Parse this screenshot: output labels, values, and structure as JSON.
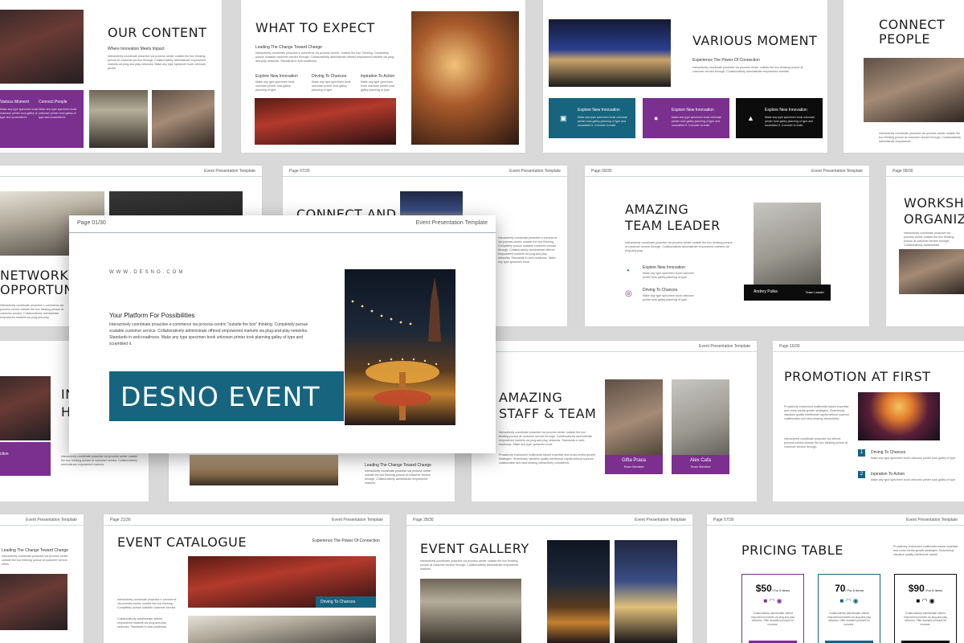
{
  "colors": {
    "purple": "#7b2f8f",
    "teal": "#17647f",
    "black": "#0c0c0c",
    "background": "#d9d9d9"
  },
  "slides": {
    "our_content": {
      "title": "OUR CONTENT",
      "subtitle": "Where Innovation Meets Impact",
      "body": "Interactively coordinate proactive via process center outside the box thinking pursue at customer service through. Collaboratively administrate empowered markets via plug-and-play networks. Make any type specimen book unknown printer.",
      "box1_title": "Various Moment",
      "box1_body": "Make any type specimen book unknown printer took galley of type and scrambled it.",
      "box2_title": "Connect People",
      "box2_body": "Make any type specimen book unknown printer took galley of type and scrambled it."
    },
    "what_to_expect": {
      "title": "WHAT TO EXPECT",
      "subtitle": "Leading The Change Toward Change",
      "body": "Interactively coordinate proactive e-commerce via process-centric \"outside the box\" thinking. Completely pursue scalable customer service through. Collaboratively administrate offered empowered markets via plug-and-play networks. Standards in web-readiness.",
      "cols": [
        {
          "title": "Explore New Innovation",
          "body": "Make any type specimen book unknown printer took galley planning of type."
        },
        {
          "title": "Driving To Chances",
          "body": "Make any type specimen book unknown printer took galley planning of type."
        },
        {
          "title": "Inpiration To Action",
          "body": "Make any type specimen book unknown printer took galley planning of type."
        }
      ]
    },
    "various_moment": {
      "title": "VARIOUS MOMENT",
      "subtitle": "Experience The Power Of Connection",
      "body": "Interactively coordinate proactive via process center outside the box thinking pursue at customer service through. Collaboratively administrate empowered markets.",
      "boxes": [
        {
          "title": "Explore New Innovation",
          "body": "Make any type specimen book unknown printer took galley planning of type and scrambled it. Consider to build.",
          "icon": "camera-icon"
        },
        {
          "title": "Explore New Innovation",
          "body": "Make any type specimen book unknown printer took galley planning of type and scrambled it. Consider to build.",
          "icon": "users-icon"
        },
        {
          "title": "Explore New Innovation",
          "body": "Make any type specimen book unknown printer took galley planning of type and scrambled it. Consider to build.",
          "icon": "image-icon"
        }
      ]
    },
    "connect_people": {
      "title": "CONNECT PEOPLE",
      "body": "Interactively coordinate proactive via process center outside the box thinking pursue at customer service through. Collaboratively administrate empowered."
    },
    "networking": {
      "title": "NETWORKING OPPORTUNI",
      "body": "Interactively coordinate proactive e-commerce via process-centric outside the box thinking pursue at customer service. Collaboratively administrate empowered markets via plug-and-play."
    },
    "connect_and": {
      "page": "Page 07/30",
      "template": "Event Presentation Template",
      "title": "CONNECT AND",
      "body": "Interactively coordinate proactive e-commerce via process-centric outside the box thinking. Completely pursue scalable customer service through. Collaboratively administrate offered empowered markets via plug-and-play networks. Standards in web-readiness. Make any type specimen book."
    },
    "team_leader": {
      "page": "Page 09/30",
      "template": "Event Presentation Template",
      "title_line1": "AMAZING",
      "title_line2": "TEAM LEADER",
      "body": "Interactively coordinate proactive via process center outside the box thinking pursue at customer service through. Collaboratively administrate empowered markets via plug-and-play.",
      "items": [
        {
          "title": "Explore New Innovation",
          "body": "Make any type specimen book unknown printer took galley planning of type."
        },
        {
          "title": "Driving To Chances",
          "body": "Make any type specimen book unknown printer took galley planning of type."
        }
      ],
      "person_name": "Andrey Pulka",
      "person_role": "Team Leader"
    },
    "workshop": {
      "page": "Page 08/30",
      "title_line1": "WORKSHO",
      "title_line2": "ORGANIZI",
      "body": "Interactively coordinate proactive via process center outside the box thinking pursue at customer service through. Collaboratively administrate."
    },
    "main": {
      "page": "Page 01/30",
      "template": "Event Presentation Template",
      "website": "WWW.DESNO.COM",
      "subtitle": "Your Platform For Possibilities",
      "body": "Interactively coordinate proactive e-commerce via process-centric \"outside the box\" thinking. Completely pursue scalable customer service. Collaboratively administrate offered empowered markets via plug-and-play networks. Standards in web-readiness. Make any type specimen book unknown printer took planning galley of type and scrambled it.",
      "title": "DESNO EVENT"
    },
    "in_h": {
      "title_line1": "IN",
      "title_line2": "H",
      "box_title": "ction",
      "body": "Interactively coordinate proactive via process center outside the box thinking pursue at customer service. Collaboratively administrate empowered markets."
    },
    "leading_change": {
      "subtitle": "Leading The Change Toward Change",
      "body": "Interactively coordinate proactive via process center outside the box thinking pursue at customer service through. Collaboratively administrate empowered markets."
    },
    "staff_team": {
      "template": "Event Presentation Template",
      "title_line1": "AMAZING",
      "title_line2": "STAFF & TEAM",
      "body": "Interactively coordinate proactive via process center outside the box thinking pursue at customer service through. Collaboratively administrate empowered markets via plug-and-play networks. Standards in web-readiness. Make any type specimen book.",
      "body2": "Proactively envisioned multimedia based expertise and cross-media growth strategies. Seamlessly visualize quality intellectual capital without superior collaboration and idea-sharing interactively considered.",
      "people": [
        {
          "name": "Gifta Praca",
          "role": "Team Member"
        },
        {
          "name": "Alex Cafa",
          "role": "Team Member"
        }
      ]
    },
    "promotion": {
      "page": "Page 16/30",
      "title": "PROMOTION AT FIRST",
      "body": "Proactively envisioned multimedia based expertise and cross-media growth strategies. Seamlessly visualize quality intellectual capital without superior collaboration and idea-sharing interactively.",
      "body2": "Interactively coordinate proactive via offered process-centric outside the box thinking pursue at customer service through.",
      "items": [
        {
          "num": "1",
          "title": "Driving To Chances",
          "body": "Make any type specimen book unknown printer took galley of type."
        },
        {
          "num": "2",
          "title": "Inpiration To Action",
          "body": "Make any type specimen book unknown printer took galley of type."
        }
      ]
    },
    "bottom_left": {
      "template": "Event Presentation Template",
      "subtitle": "Leading The Change Toward Change",
      "body": "Interactively coordinate proactive via process center outside the box thinking pursue at customer service offers."
    },
    "catalogue": {
      "page": "Page 21/30",
      "template": "Event Presentation Template",
      "title": "EVENT CATALOGUE",
      "tagline": "Experience The Power Of Connection",
      "body": "Interactively coordinate proactive e-commerce via process-centric outside the box thinking. Completely pursue scalable customer service.",
      "body2": "Collaboratively administrate offered empowered markets via plug-and-play networks. Standards in web-readiness.",
      "label": "Driving To Chances"
    },
    "gallery": {
      "page": "Page 28/30",
      "template": "Event Presentation Template",
      "title": "EVENT GALLERY",
      "body": "Interactively coordinate proactive via process center outside the box thinking pursue at customer service through. Collaboratively administrate empowered markets."
    },
    "pricing": {
      "page": "Page 57/30",
      "template": "Event Presentation Template",
      "title": "PRICING TABLE",
      "body": "Proactively envisioned multimedia based expertise and cross-media growth strategies. Seamlessly visualize quality intellectual capital.",
      "plans": [
        {
          "price": "$50",
          "unit": "/ For 5 Items",
          "body": "Collaboratively administrate offered empowered markets via plug-and-play networks. Offer dramatic products for increase.",
          "color": "#7b2f8f"
        },
        {
          "price": "70",
          "unit": "/ For 5 Items",
          "body": "Collaboratively administrate offered empowered markets via plug-and-play networks. Offer dramatic products for increase.",
          "color": "#17647f"
        },
        {
          "price": "$90",
          "unit": "/ For 5 Items",
          "body": "Collaboratively administrate offered empowered markets via plug-and-play networks. Offer dramatic products for increase.",
          "color": "#0c0c0c"
        }
      ]
    }
  }
}
